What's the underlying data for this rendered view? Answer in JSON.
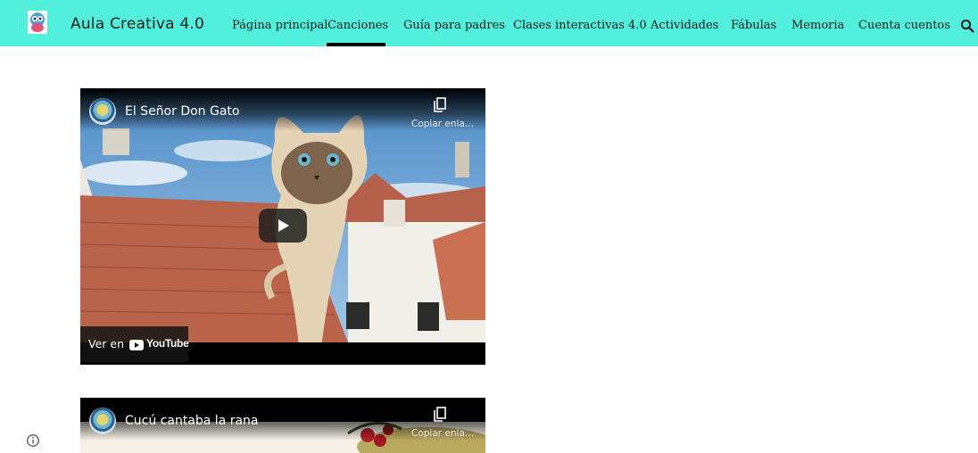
{
  "site": {
    "title": "Aula Creativa 4.0"
  },
  "nav": {
    "items": [
      {
        "label": "Página principal"
      },
      {
        "label": "Canciones",
        "active": true
      },
      {
        "label": "Guía para padres"
      },
      {
        "label": "Clases interactivas 4.0"
      },
      {
        "label": "Actividades"
      },
      {
        "label": "Fábulas"
      },
      {
        "label": "Memoria"
      },
      {
        "label": "Cuenta cuentos"
      }
    ],
    "search_icon": "search-icon"
  },
  "videos": [
    {
      "title": "El Señor Don Gato",
      "copy_label": "Copiar enla...",
      "watch_on": "Ver en",
      "youtube": "YouTube"
    },
    {
      "title": "Cucú cantaba la rana",
      "copy_label": "Copiar enla..."
    }
  ],
  "colors": {
    "header_bg": "#52efdc",
    "active_underline": "#000000",
    "video_bg": "#000000"
  }
}
